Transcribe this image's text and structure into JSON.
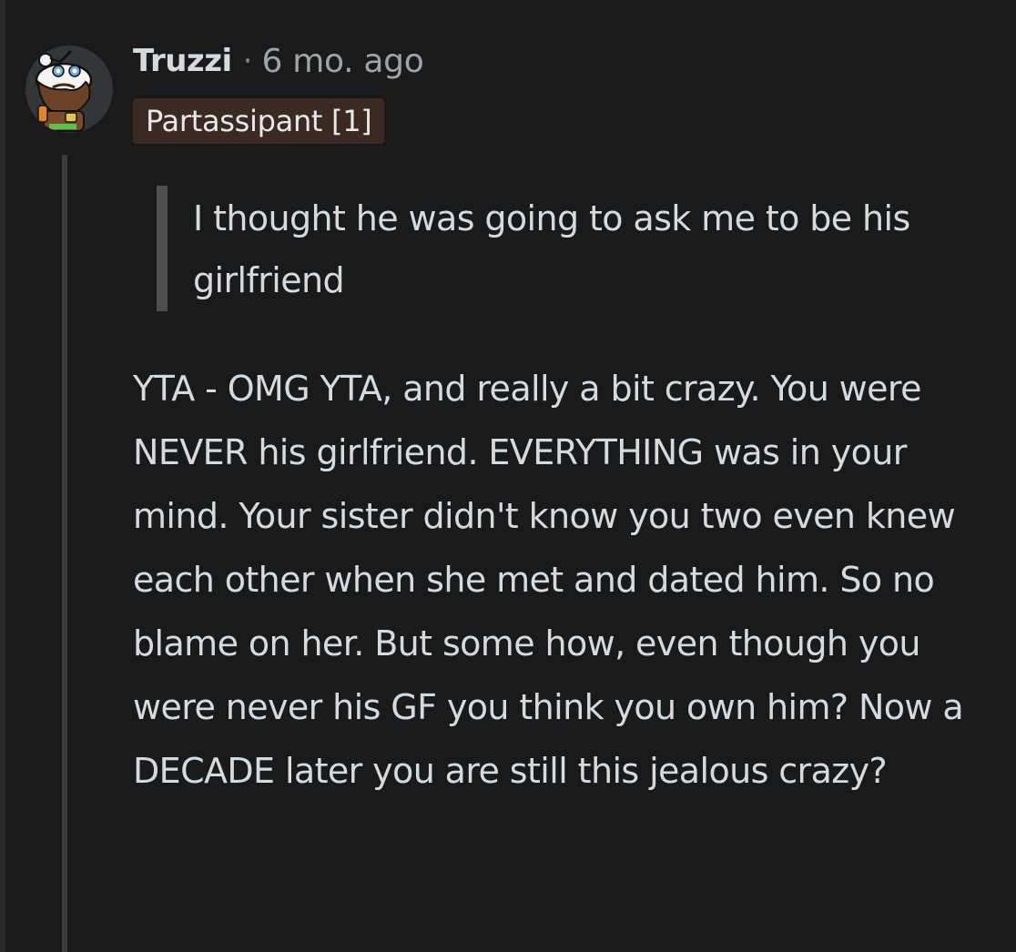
{
  "comment": {
    "author": "Truzzi",
    "separator": "·",
    "timestamp": "6 mo. ago",
    "flair": "Partassipant [1]",
    "quote": "I thought he was going to ask me to be his girlfriend",
    "body": "YTA - OMG YTA, and really a bit crazy. You were NEVER his girlfriend. EVERYTHING was in your mind. Your sister didn't know you two even knew each other when she met and dated him. So no blame on her. But some how, even though you were never his GF you think you own him? Now a DECADE later you are still this jealous crazy?"
  },
  "colors": {
    "background": "#1a1a1b",
    "text": "#d7dadc",
    "meta": "#a1a3a5",
    "flair_bg": "#3b2a24",
    "thread_line": "#3b3b3c",
    "quote_bar": "#4f4f50"
  },
  "icons": {
    "avatar": "snoo-avatar-bearded-chef-icon"
  }
}
